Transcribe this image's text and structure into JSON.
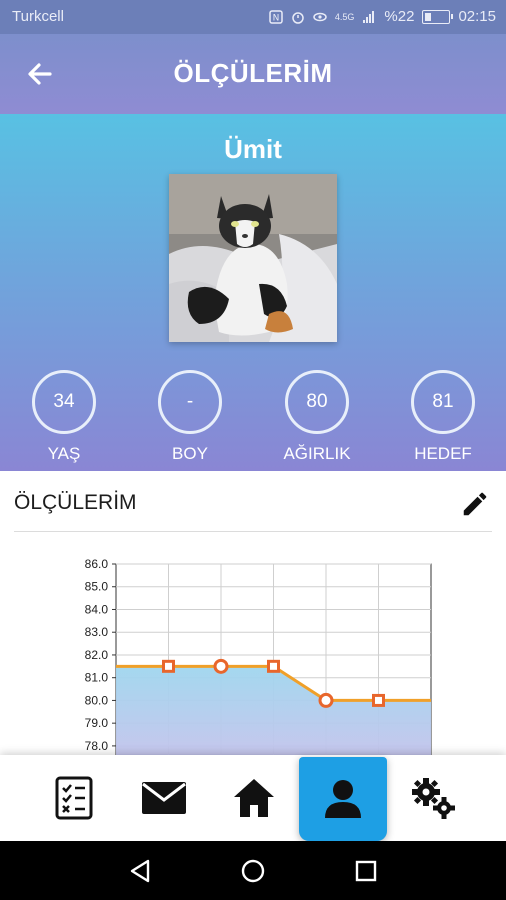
{
  "status_bar": {
    "carrier": "Turkcell",
    "network": "4.5G",
    "battery_text": "%22",
    "time": "02:15"
  },
  "app_bar": {
    "title": "ÖLÇÜLERİM",
    "back_icon": "arrow-left-icon"
  },
  "profile": {
    "name": "Ümit",
    "photo_desc": "cat-photo",
    "stats": [
      {
        "value": "34",
        "label": "YAŞ"
      },
      {
        "value": "-",
        "label": "BOY"
      },
      {
        "value": "80",
        "label": "AĞIRLIK"
      },
      {
        "value": "81",
        "label": "HEDEF"
      }
    ]
  },
  "section": {
    "title": "ÖLÇÜLERİM",
    "edit_icon": "pencil-icon"
  },
  "chart_data": {
    "type": "line",
    "y_ticks": [
      "86.0",
      "85.0",
      "84.0",
      "83.0",
      "82.0",
      "81.0",
      "80.0",
      "79.0",
      "78.0"
    ],
    "ylim": [
      77.6,
      86.0
    ],
    "x": [
      0,
      1,
      2,
      3,
      4,
      5,
      6
    ],
    "values": [
      81.5,
      81.5,
      81.5,
      81.5,
      80.0,
      80.0,
      80.0
    ],
    "markers": [
      {
        "x": 1,
        "y": 81.5,
        "shape": "square"
      },
      {
        "x": 2,
        "y": 81.5,
        "shape": "circle"
      },
      {
        "x": 3,
        "y": 81.5,
        "shape": "square"
      },
      {
        "x": 4,
        "y": 80.0,
        "shape": "circle"
      },
      {
        "x": 5,
        "y": 80.0,
        "shape": "square"
      }
    ],
    "grid": true,
    "fill": "area",
    "line_color": "#f0a029",
    "fill_color": "#a9d8ef",
    "marker_color": "#e8662c"
  },
  "bottom_nav": {
    "items": [
      {
        "icon": "checklist-icon",
        "active": false
      },
      {
        "icon": "mail-icon",
        "active": false
      },
      {
        "icon": "home-icon",
        "active": false
      },
      {
        "icon": "user-icon",
        "active": true
      },
      {
        "icon": "gears-icon",
        "active": false
      }
    ],
    "active_color": "#1e9fe4"
  },
  "system_nav": {
    "items": [
      "back-triangle-icon",
      "home-circle-icon",
      "recents-square-icon"
    ]
  }
}
